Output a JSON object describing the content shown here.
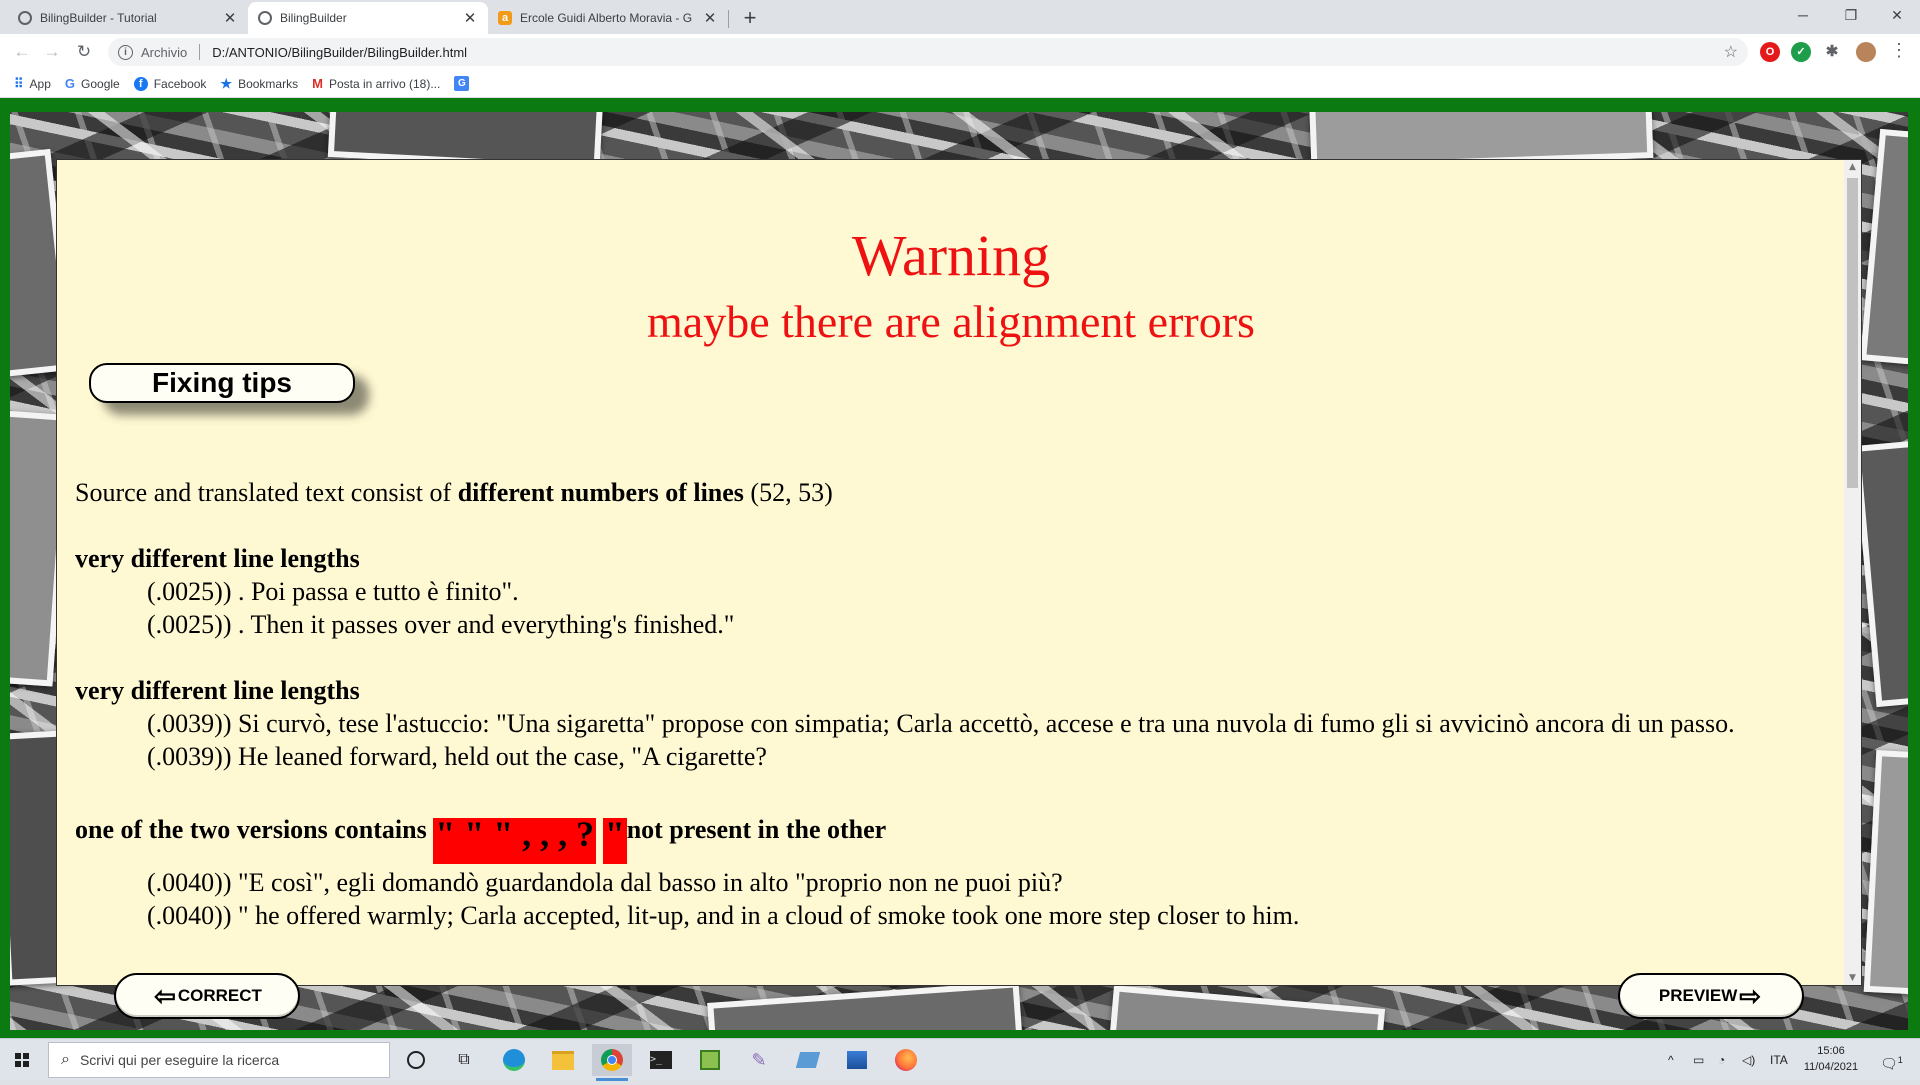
{
  "browser": {
    "tabs": [
      {
        "title": "BilingBuilder - Tutorial",
        "active": false
      },
      {
        "title": "BilingBuilder",
        "active": true
      },
      {
        "title": "Ercole Guidi Alberto Moravia - G",
        "active": false
      }
    ],
    "new_tab": "+",
    "address": {
      "scheme": "Archivio",
      "path": "D:/ANTONIO/BilingBuilder/BilingBuilder.html"
    },
    "bookmarks": [
      {
        "label": "App",
        "icon": "apps-grid-icon"
      },
      {
        "label": "Google",
        "icon": "google-icon"
      },
      {
        "label": "Facebook",
        "icon": "facebook-icon"
      },
      {
        "label": "Bookmarks",
        "icon": "star-icon"
      },
      {
        "label": "Posta in arrivo (18)...",
        "icon": "gmail-icon"
      }
    ]
  },
  "page": {
    "warning_title": "Warning",
    "warning_subtitle": "maybe there are alignment errors",
    "fixing_tips_label": "Fixing tips",
    "line_count": {
      "prefix": "Source and translated text consist of ",
      "emphasis": "different numbers of lines",
      "suffix": " (52, 53)"
    },
    "issues": [
      {
        "heading": "very different line lengths",
        "source": "(.0025)) . Poi passa e tutto è finito\".",
        "target": "(.0025)) . Then it passes over and everything's finished.\""
      },
      {
        "heading": "very different line lengths",
        "source": "(.0039)) Si curvò, tese l'astuccio: \"Una sigaretta\" propose con simpatia; Carla accettò, accese e tra una nuvola di fumo gli si avvicinò ancora di un passo.",
        "target": "(.0039)) He leaned forward, held out the case, \"A cigarette?"
      }
    ],
    "punct_issue": {
      "prefix": "one of the two versions contains ",
      "highlight_1": "\" \" \" , , , ?",
      "highlight_2": "\"",
      "suffix": "not present in the other",
      "source": "(.0040)) \"E così\", egli domandò guardandola dal basso in alto \"proprio non ne puoi più?",
      "target": "(.0040)) \" he offered warmly; Carla accepted, lit-up, and in a cloud of smoke took one more step closer to him."
    },
    "correct_label": "CORRECT",
    "preview_label": "PREVIEW"
  },
  "taskbar": {
    "search_placeholder": "Scrivi qui per eseguire la ricerca",
    "language": "ITA",
    "time": "15:06",
    "date": "11/04/2021",
    "notifications": "1"
  },
  "colors": {
    "warning_red": "#ee1111",
    "panel_bg": "#fff9d3",
    "frame_green": "#0b7a10",
    "highlight_red": "#ff0000"
  }
}
